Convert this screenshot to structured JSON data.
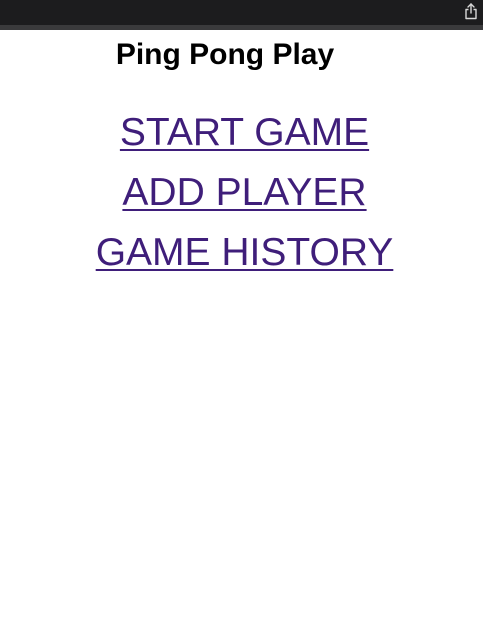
{
  "browser": {
    "share_icon": "share-icon"
  },
  "page": {
    "title": "Ping Pong Play"
  },
  "nav": {
    "items": [
      {
        "label": "START GAME"
      },
      {
        "label": "ADD PLAYER"
      },
      {
        "label": "GAME HISTORY"
      }
    ]
  },
  "colors": {
    "browser_bar": "#1c1c1e",
    "link": "#3f1e7a",
    "title": "#000000",
    "background": "#ffffff"
  }
}
